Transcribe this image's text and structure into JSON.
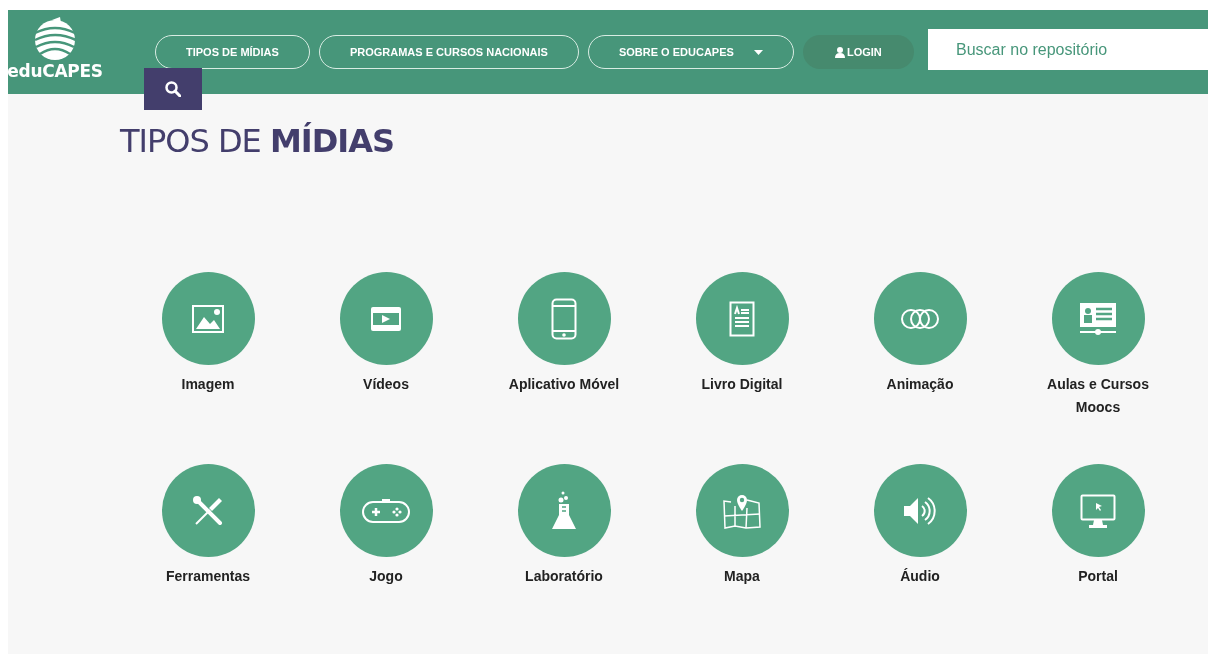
{
  "header": {
    "logo": "eduCAPES",
    "nav": [
      {
        "label": "TIPOS DE MÍDIAS",
        "kind": "link"
      },
      {
        "label": "PROGRAMAS E CURSOS NACIONAIS",
        "kind": "link"
      },
      {
        "label": "SOBRE O EDUCAPES",
        "kind": "dropdown"
      },
      {
        "label": "LOGIN",
        "kind": "login"
      }
    ],
    "search": {
      "placeholder": "Buscar no repositório"
    }
  },
  "title": "TIPOS DE **MÍDIAS**",
  "media_types": [
    {
      "label": "Imagem",
      "kind": "image"
    },
    {
      "label": "Vídeos",
      "kind": "video"
    },
    {
      "label": "Aplicativo Móvel",
      "kind": "mobile"
    },
    {
      "label": "Livro Digital",
      "kind": "book"
    },
    {
      "label": "Animação",
      "kind": "animation"
    },
    {
      "label": "Aulas e Cursos Moocs",
      "kind": "course"
    },
    {
      "label": "Ferramentas",
      "kind": "tools"
    },
    {
      "label": "Jogo",
      "kind": "game"
    },
    {
      "label": "Laboratório",
      "kind": "lab"
    },
    {
      "label": "Mapa",
      "kind": "map"
    },
    {
      "label": "Áudio",
      "kind": "audio"
    },
    {
      "label": "Portal",
      "kind": "portal"
    }
  ]
}
